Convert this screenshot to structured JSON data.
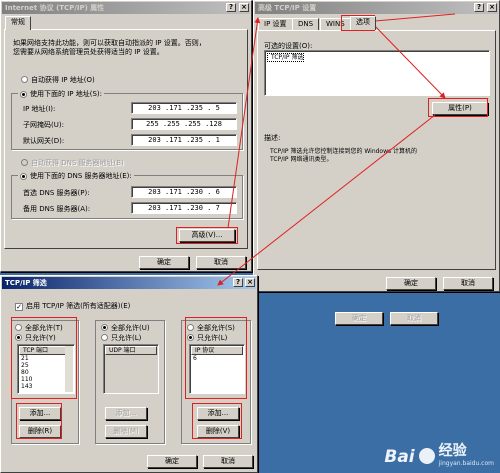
{
  "tcpip_props": {
    "title": "Internet 协议 (TCP/IP) 属性",
    "title_buttons": [
      "?",
      "×"
    ],
    "tab_general": "常规",
    "intro": [
      "如果网络支持此功能，则可以获取自动指派的 IP 设置。否则，",
      "您需要从网络系统管理员处获得适当的 IP 设置。"
    ],
    "auto_ip": "自动获得 IP 地址(O)",
    "manual_ip": "使用下面的 IP 地址(S):",
    "ip_label": "IP 地址(I):",
    "ip_value": "203 .171 .235 . 5",
    "mask_label": "子网掩码(U):",
    "mask_value": "255 .255 .255 .128",
    "gateway_label": "默认网关(D):",
    "gateway_value": "203 .171 .235 . 1",
    "auto_dns": "自动获得 DNS 服务器地址(B)",
    "manual_dns": "使用下面的 DNS 服务器地址(E):",
    "dns1_label": "首选 DNS 服务器(P):",
    "dns1_value": "203 .171 .230 . 6",
    "dns2_label": "备用 DNS 服务器(A):",
    "dns2_value": "203 .171 .230 . 7",
    "advanced_button": "高级(V)...",
    "ok": "确定",
    "cancel": "取消"
  },
  "advanced_tcpip": {
    "title": "高级 TCP/IP 设置",
    "title_buttons": [
      "?",
      "×"
    ],
    "tabs": [
      "IP 设置",
      "DNS",
      "WINS",
      "选项"
    ],
    "optional_label": "可选的设置(O):",
    "list_item": "TCP/IP 筛选",
    "properties_button": "属性(P)",
    "desc_title": "描述:",
    "desc_lines": [
      "TCP/IP 筛选允许您控制连接到您的 Windows 计算机的",
      "TCP/IP 网络通讯类型。"
    ],
    "ok": "确定",
    "cancel": "取消"
  },
  "tcpip_filter": {
    "title": "TCP/IP 筛选",
    "title_buttons": [
      "?",
      "×"
    ],
    "enable_all": "启用 TCP/IP 筛选(所有适配器)(E)",
    "tcp": {
      "allow_all": "全部允许(T)",
      "allow_only": "只允许(Y)",
      "header": "TCP 端口",
      "items": [
        "21",
        "25",
        "80",
        "110",
        "143"
      ],
      "add": "添加...",
      "remove": "删除(R)"
    },
    "udp": {
      "allow_all": "全部允许(U)",
      "allow_only": "只允许(L)",
      "header": "UDP 端口",
      "add": "添加...",
      "remove": "删除(M)"
    },
    "ip": {
      "allow_all": "全部允许(S)",
      "allow_only": "只允许(L)",
      "header": "IP 协议",
      "items": [
        "6"
      ],
      "add": "添加...",
      "remove": "删除(V)"
    },
    "ok": "确定",
    "cancel": "取消"
  },
  "behind": {
    "ok": "确定",
    "cancel": "取消"
  },
  "watermark": {
    "brand_a": "Bai",
    "brand_b": "经验",
    "url": "jingyan.baidu.com"
  },
  "colors": {
    "desktop": "#3a6ea5",
    "dialog": "#d4d0c8",
    "title_active": "#0a246a",
    "annotation": "#e02020"
  }
}
